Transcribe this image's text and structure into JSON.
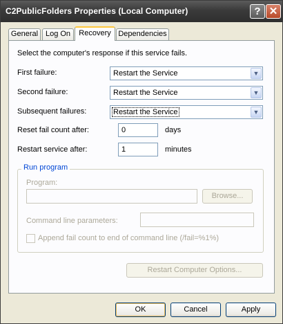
{
  "window": {
    "title": "C2PublicFolders Properties (Local Computer)",
    "help_glyph": "?",
    "close_glyph": "✕"
  },
  "tabs": [
    "General",
    "Log On",
    "Recovery",
    "Dependencies"
  ],
  "recovery": {
    "intro": "Select the computer's response if this service fails.",
    "first_failure": {
      "label": "First failure:",
      "value": "Restart the Service"
    },
    "second_failure": {
      "label": "Second failure:",
      "value": "Restart the Service"
    },
    "subsequent_failures": {
      "label": "Subsequent failures:",
      "value": "Restart the Service"
    },
    "reset_count": {
      "label": "Reset fail count after:",
      "value": "0",
      "unit": "days"
    },
    "restart_service": {
      "label": "Restart service after:",
      "value": "1",
      "unit": "minutes"
    },
    "run_program": {
      "legend": "Run program",
      "program_label": "Program:",
      "browse_label": "Browse...",
      "params_label": "Command line parameters:",
      "append_label": "Append fail count to end of command line (/fail=%1%)"
    },
    "restart_options_label": "Restart Computer Options..."
  },
  "footer": {
    "ok": "OK",
    "cancel": "Cancel",
    "apply": "Apply"
  },
  "colors": {
    "titlebar": "#3a3a3a",
    "dialog_bg": "#ece9d8",
    "panel_bg": "#fcfcfe",
    "group_legend": "#0046d5",
    "disabled_text": "#aca899"
  }
}
